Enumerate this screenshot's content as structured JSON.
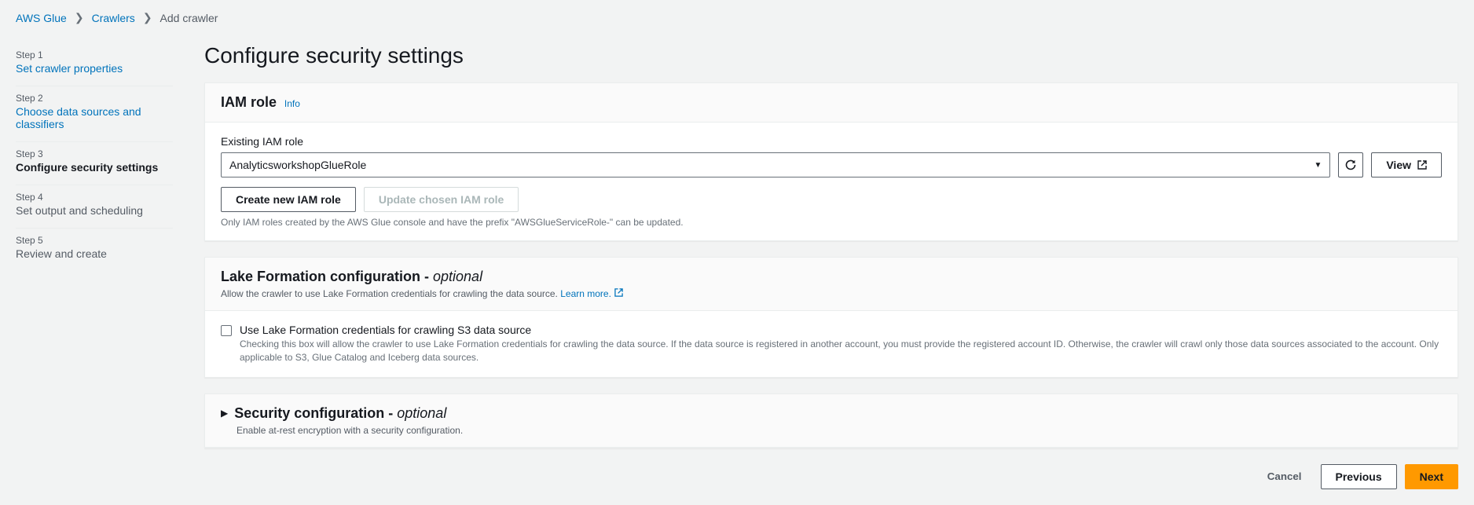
{
  "breadcrumb": {
    "items": [
      "AWS Glue",
      "Crawlers"
    ],
    "current": "Add crawler"
  },
  "sidebar": {
    "steps": [
      {
        "num": "Step 1",
        "title": "Set crawler properties",
        "state": "link"
      },
      {
        "num": "Step 2",
        "title": "Choose data sources and classifiers",
        "state": "link"
      },
      {
        "num": "Step 3",
        "title": "Configure security settings",
        "state": "active"
      },
      {
        "num": "Step 4",
        "title": "Set output and scheduling",
        "state": "future"
      },
      {
        "num": "Step 5",
        "title": "Review and create",
        "state": "future"
      }
    ]
  },
  "page": {
    "title": "Configure security settings"
  },
  "iam": {
    "panel_title": "IAM role",
    "info": "Info",
    "field_label": "Existing IAM role",
    "selected": "AnalyticsworkshopGlueRole",
    "view": "View",
    "create_btn": "Create new IAM role",
    "update_btn": "Update chosen IAM role",
    "hint": "Only IAM roles created by the AWS Glue console and have the prefix \"AWSGlueServiceRole-\" can be updated."
  },
  "lake": {
    "title_main": "Lake Formation configuration - ",
    "title_sub": "optional",
    "desc": "Allow the crawler to use Lake Formation credentials for crawling the data source.",
    "learn_more": "Learn more.",
    "checkbox_label": "Use Lake Formation credentials for crawling S3 data source",
    "checkbox_desc": "Checking this box will allow the crawler to use Lake Formation credentials for crawling the data source. If the data source is registered in another account, you must provide the registered account ID. Otherwise, the crawler will crawl only those data sources associated to the account. Only applicable to S3, Glue Catalog and Iceberg data sources."
  },
  "security": {
    "title_main": "Security configuration - ",
    "title_sub": "optional",
    "desc": "Enable at-rest encryption with a security configuration."
  },
  "footer": {
    "cancel": "Cancel",
    "previous": "Previous",
    "next": "Next"
  }
}
